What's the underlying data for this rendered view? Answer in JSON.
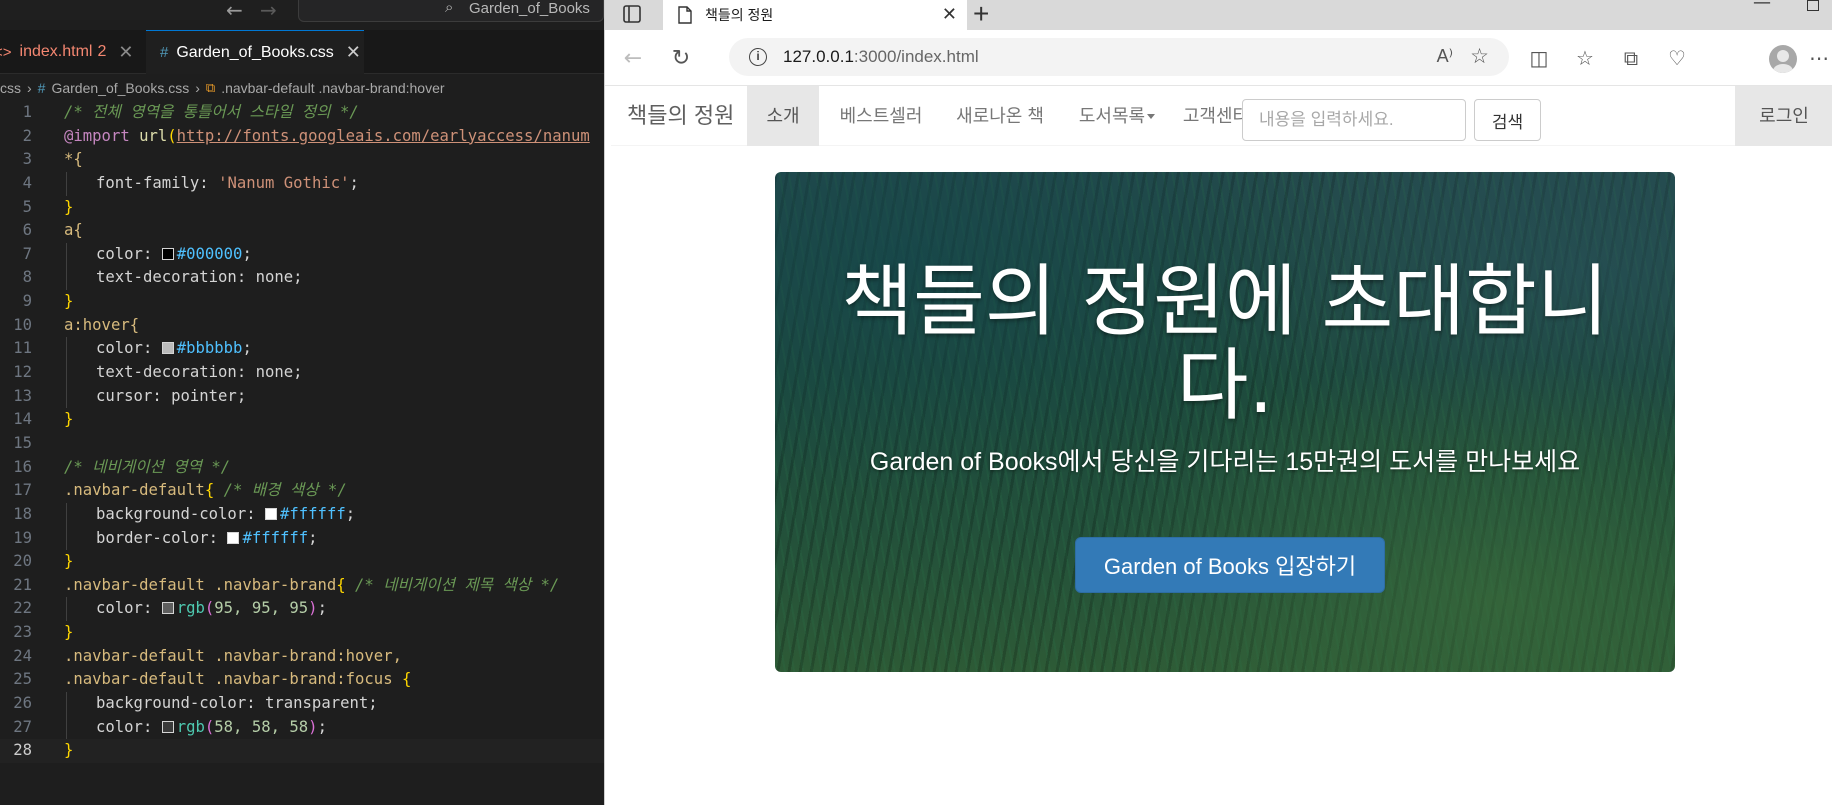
{
  "editor": {
    "title_search": "Garden_of_Books",
    "tabs": [
      {
        "label": "index.html",
        "badge": "2"
      },
      {
        "label": "Garden_of_Books.css"
      }
    ],
    "breadcrumb": [
      "css",
      "Garden_of_Books.css",
      ".navbar-default .navbar-brand:hover"
    ],
    "line_numbers": [
      "1",
      "2",
      "3",
      "4",
      "5",
      "6",
      "7",
      "8",
      "9",
      "10",
      "11",
      "12",
      "13",
      "14",
      "15",
      "16",
      "17",
      "18",
      "19",
      "20",
      "21",
      "22",
      "23",
      "24",
      "25",
      "26",
      "27",
      "28"
    ],
    "code": {
      "l1": "/* 전체 영역을 통틀어서 스타일 정의 */",
      "l2_kw": "@import",
      "l2_fn": "url",
      "l2_url": "http://fonts.googleais.com/earlyaccess/nanum",
      "l3": "*{",
      "l4_prop": "font-family: ",
      "l4_val": "'Nanum Gothic'",
      "l5": "}",
      "l6": "a{",
      "l7_prop": "color: ",
      "l7_val": "#000000",
      "l8": "text-decoration: none;",
      "l9": "}",
      "l10": "a:hover{",
      "l11_prop": "color: ",
      "l11_val": "#bbbbbb",
      "l12": "text-decoration: none;",
      "l13": "cursor: pointer;",
      "l14": "}",
      "l16": "/* 네비게이션 영역 */",
      "l17_sel": ".navbar-default",
      "l17_cm": "/* 배경 색상 */",
      "l18_prop": "background-color: ",
      "l18_val": "#ffffff",
      "l19_prop": "border-color: ",
      "l19_val": "#ffffff",
      "l20": "}",
      "l21_sel": ".navbar-default .navbar-brand",
      "l21_cm": "/* 네비게이션 제목 색상 */",
      "l22_prop": "color: ",
      "l22_fn": "rgb",
      "l22_args": "95, 95, 95",
      "l23": "}",
      "l24": ".navbar-default .navbar-brand:hover,",
      "l25": ".navbar-default .navbar-brand:focus ",
      "l26": "background-color: transparent;",
      "l27_prop": "color: ",
      "l27_fn": "rgb",
      "l27_args": "58, 58, 58",
      "l28": "}"
    },
    "swatches": {
      "black": "#000000",
      "grey": "#bbbbbb",
      "white": "#ffffff",
      "rgb95": "#5f5f5f",
      "rgb58": "#3a3a3a"
    }
  },
  "browser": {
    "tab_title": "책들의 정원",
    "url_host": "127.0.0.1",
    "url_path": ":3000/index.html",
    "icons": [
      "back-icon",
      "refresh-icon",
      "info-icon",
      "read-aloud-icon",
      "favorite-star-icon",
      "split-screen-icon",
      "favorites-icon",
      "collections-icon",
      "browser-essentials-icon",
      "profile-avatar",
      "more-icon"
    ]
  },
  "page": {
    "brand": "책들의 정원",
    "nav": [
      "소개",
      "베스트셀러",
      "새로나온 책",
      "도서목록",
      "고객센터"
    ],
    "search_placeholder": "내용을 입력하세요.",
    "search_button": "검색",
    "login": "로그인",
    "hero_title": "책들의 정원에 초대합니다.",
    "hero_subtitle": "Garden of Books에서 당신을 기다리는 15만권의 도서를 만나보세요",
    "hero_button": "Garden of Books 입장하기"
  }
}
